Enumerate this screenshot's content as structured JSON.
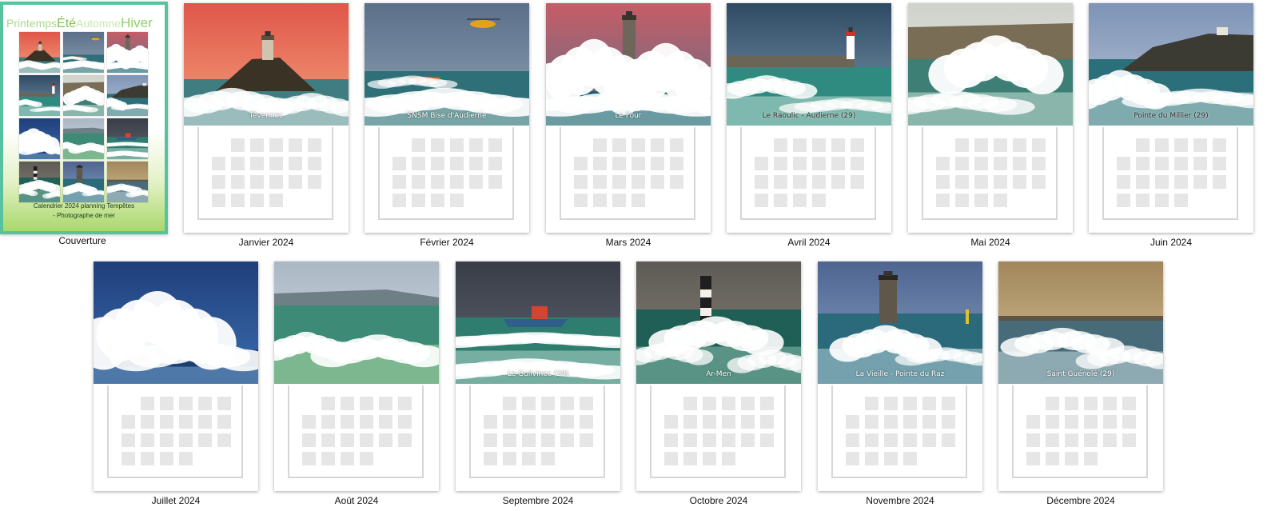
{
  "cover": {
    "seasons": [
      "Printemps",
      "Été",
      "Automne",
      "Hiver"
    ],
    "subtitle": "Calendrier 2024 planning Tempêtes",
    "author_prefix": "",
    "author_suffix": "- Photographe de mer",
    "label": "Couverture"
  },
  "months": [
    {
      "label": "Janvier 2024",
      "caption": "Tévennec",
      "scene": "rock-lighthouse-red-sky"
    },
    {
      "label": "Février 2024",
      "caption": "SNSM Bise d'Audierne",
      "scene": "rescue-boat-helicopter"
    },
    {
      "label": "Mars 2024",
      "caption": "Le Four",
      "scene": "lighthouse-wave-splash"
    },
    {
      "label": "Avril 2024",
      "caption": "Le Raoulic - Audierne (29)",
      "scene": "jetty-lighthouse"
    },
    {
      "label": "Mai 2024",
      "caption": "",
      "scene": "breaking-wave-cliff"
    },
    {
      "label": "Juin 2024",
      "caption": "Pointe du Millier (29)",
      "scene": "headland-house"
    },
    {
      "label": "Juillet 2024",
      "caption": "",
      "scene": "wave-explosion-blue"
    },
    {
      "label": "Août 2024",
      "caption": "",
      "scene": "green-wave-birds"
    },
    {
      "label": "Septembre 2024",
      "caption": "Le Guilvinec (29)",
      "scene": "fishing-boat-storm"
    },
    {
      "label": "Octobre 2024",
      "caption": "Ar-Men",
      "scene": "striped-lighthouse"
    },
    {
      "label": "Novembre 2024",
      "caption": "La Vieille - Pointe du Raz",
      "scene": "tower-lighthouse-sea"
    },
    {
      "label": "Décembre 2024",
      "caption": "Saint Guénolé (29)",
      "scene": "golden-storm-rocks"
    }
  ],
  "colors": {
    "cover_border": "#58c2a0",
    "cell_fill": "#e6e6e6",
    "frame": "#d6d6d6"
  }
}
